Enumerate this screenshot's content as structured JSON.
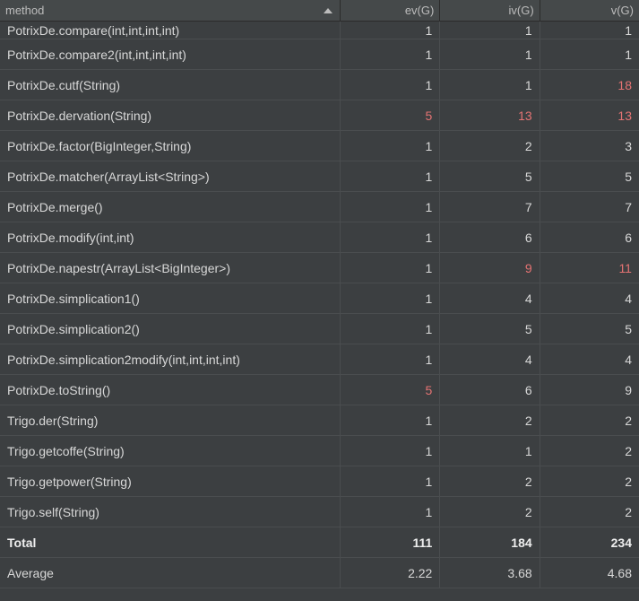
{
  "columns": {
    "method": "method",
    "ev": "ev(G)",
    "iv": "iv(G)",
    "v": "v(G)"
  },
  "rows": [
    {
      "method": "PotrixDe.compare(int,int,int,int)",
      "ev": "1",
      "iv": "1",
      "v": "1",
      "cutoff": true
    },
    {
      "method": "PotrixDe.compare2(int,int,int,int)",
      "ev": "1",
      "iv": "1",
      "v": "1"
    },
    {
      "method": "PotrixDe.cutf(String)",
      "ev": "1",
      "iv": "1",
      "v": "18",
      "v_warn": true
    },
    {
      "method": "PotrixDe.dervation(String)",
      "ev": "5",
      "iv": "13",
      "v": "13",
      "ev_warn": true,
      "iv_warn": true,
      "v_warn": true
    },
    {
      "method": "PotrixDe.factor(BigInteger,String)",
      "ev": "1",
      "iv": "2",
      "v": "3"
    },
    {
      "method": "PotrixDe.matcher(ArrayList<String>)",
      "ev": "1",
      "iv": "5",
      "v": "5"
    },
    {
      "method": "PotrixDe.merge()",
      "ev": "1",
      "iv": "7",
      "v": "7"
    },
    {
      "method": "PotrixDe.modify(int,int)",
      "ev": "1",
      "iv": "6",
      "v": "6"
    },
    {
      "method": "PotrixDe.napestr(ArrayList<BigInteger>)",
      "ev": "1",
      "iv": "9",
      "v": "11",
      "iv_warn": true,
      "v_warn": true
    },
    {
      "method": "PotrixDe.simplication1()",
      "ev": "1",
      "iv": "4",
      "v": "4"
    },
    {
      "method": "PotrixDe.simplication2()",
      "ev": "1",
      "iv": "5",
      "v": "5"
    },
    {
      "method": "PotrixDe.simplication2modify(int,int,int,int)",
      "ev": "1",
      "iv": "4",
      "v": "4"
    },
    {
      "method": "PotrixDe.toString()",
      "ev": "5",
      "iv": "6",
      "v": "9",
      "ev_warn": true
    },
    {
      "method": "Trigo.der(String)",
      "ev": "1",
      "iv": "2",
      "v": "2"
    },
    {
      "method": "Trigo.getcoffe(String)",
      "ev": "1",
      "iv": "1",
      "v": "2"
    },
    {
      "method": "Trigo.getpower(String)",
      "ev": "1",
      "iv": "2",
      "v": "2"
    },
    {
      "method": "Trigo.self(String)",
      "ev": "1",
      "iv": "2",
      "v": "2"
    }
  ],
  "summary": [
    {
      "label": "Total",
      "ev": "111",
      "iv": "184",
      "v": "234",
      "bold": true
    },
    {
      "label": "Average",
      "ev": "2.22",
      "iv": "3.68",
      "v": "4.68"
    }
  ],
  "chart_data": {
    "type": "table",
    "title": "Cyclomatic complexity metrics per method",
    "columns": [
      "method",
      "ev(G)",
      "iv(G)",
      "v(G)"
    ],
    "rows": [
      [
        "PotrixDe.compare(int,int,int,int)",
        1,
        1,
        1
      ],
      [
        "PotrixDe.compare2(int,int,int,int)",
        1,
        1,
        1
      ],
      [
        "PotrixDe.cutf(String)",
        1,
        1,
        18
      ],
      [
        "PotrixDe.dervation(String)",
        5,
        13,
        13
      ],
      [
        "PotrixDe.factor(BigInteger,String)",
        1,
        2,
        3
      ],
      [
        "PotrixDe.matcher(ArrayList<String>)",
        1,
        5,
        5
      ],
      [
        "PotrixDe.merge()",
        1,
        7,
        7
      ],
      [
        "PotrixDe.modify(int,int)",
        1,
        6,
        6
      ],
      [
        "PotrixDe.napestr(ArrayList<BigInteger>)",
        1,
        9,
        11
      ],
      [
        "PotrixDe.simplication1()",
        1,
        4,
        4
      ],
      [
        "PotrixDe.simplication2()",
        1,
        5,
        5
      ],
      [
        "PotrixDe.simplication2modify(int,int,int,int)",
        1,
        4,
        4
      ],
      [
        "PotrixDe.toString()",
        5,
        6,
        9
      ],
      [
        "Trigo.der(String)",
        1,
        2,
        2
      ],
      [
        "Trigo.getcoffe(String)",
        1,
        1,
        2
      ],
      [
        "Trigo.getpower(String)",
        1,
        2,
        2
      ],
      [
        "Trigo.self(String)",
        1,
        2,
        2
      ]
    ],
    "total": {
      "ev(G)": 111,
      "iv(G)": 184,
      "v(G)": 234
    },
    "average": {
      "ev(G)": 2.22,
      "iv(G)": 3.68,
      "v(G)": 4.68
    }
  }
}
